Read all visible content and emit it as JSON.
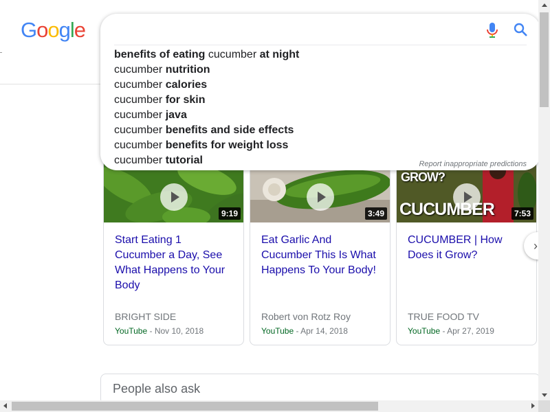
{
  "logo": {
    "letters": [
      "G",
      "o",
      "o",
      "g",
      "l",
      "e"
    ],
    "colors": [
      "#4285f4",
      "#ea4335",
      "#fbbc05",
      "#4285f4",
      "#34a853",
      "#ea4335"
    ]
  },
  "search": {
    "value": "",
    "mic_icon": "mic-icon",
    "search_icon": "search-icon"
  },
  "suggestions": [
    {
      "a": "benefits of eating",
      "b": " cucumber ",
      "c": "at night"
    },
    {
      "a": "",
      "b": "cucumber ",
      "c": "nutrition"
    },
    {
      "a": "",
      "b": "cucumber ",
      "c": "calories"
    },
    {
      "a": "",
      "b": "cucumber ",
      "c": "for skin"
    },
    {
      "a": "",
      "b": "cucumber ",
      "c": "java"
    },
    {
      "a": "",
      "b": "cucumber ",
      "c": "benefits and side effects"
    },
    {
      "a": "",
      "b": "cucumber ",
      "c": "benefits for weight loss"
    },
    {
      "a": "",
      "b": "cucumber ",
      "c": "tutorial"
    }
  ],
  "report_link": "Report inappropriate predictions",
  "videos": [
    {
      "title": "Start Eating 1 Cucumber a Day, See What Happens to Your Body",
      "channel": "BRIGHT SIDE",
      "source": "YouTube",
      "date": " - Nov 10, 2018",
      "duration": "9:19"
    },
    {
      "title": "Eat Garlic And Cucumber This Is What Happens To Your Body!",
      "channel": "Robert von Rotz Roy",
      "source": "YouTube",
      "date": " - Apr 14, 2018",
      "duration": "3:49"
    },
    {
      "title": "CUCUMBER | How Does it Grow?",
      "channel": "TRUE FOOD TV",
      "source": "YouTube",
      "date": " - Apr 27, 2019",
      "duration": "7:53",
      "thumb_text_top": "DOES IT\nGROW?",
      "thumb_text_big": "CUCUMBER"
    }
  ],
  "next_arrow": "›",
  "people_also_ask": "People also ask"
}
